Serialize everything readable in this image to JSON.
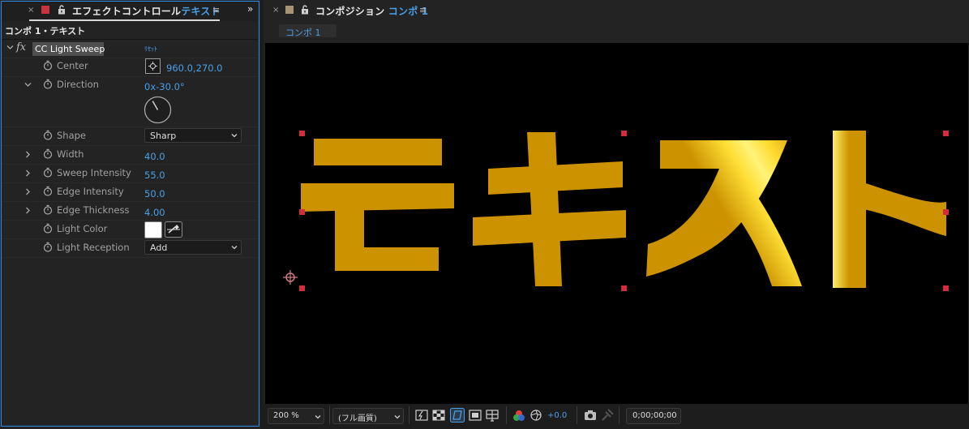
{
  "effect_controls": {
    "tab": {
      "close": "×",
      "lock_icon": "unlock-icon",
      "title": "エフェクトコントロール",
      "layer": "テキスト",
      "menu": "≡",
      "swatch_color": "#c8323c"
    },
    "panel_expand": "»",
    "breadcrumb": "コンポ 1・テキスト",
    "effect": {
      "fx_label": "fx",
      "name": "CC Light Sweep",
      "reset": "ﾘｾｯﾄ"
    },
    "properties": [
      {
        "label": "Center",
        "value": "960.0,270.0"
      },
      {
        "label": "Direction",
        "value_prefix": "0x",
        "value": "-30.0°",
        "dial_angle": -30
      },
      {
        "label": "Shape",
        "value": "Sharp"
      },
      {
        "label": "Width",
        "value": "40.0"
      },
      {
        "label": "Sweep Intensity",
        "value": "55.0"
      },
      {
        "label": "Edge Intensity",
        "value": "50.0"
      },
      {
        "label": "Edge Thickness",
        "value": "4.00"
      },
      {
        "label": "Light Color",
        "value": "#ffffff"
      },
      {
        "label": "Light Reception",
        "value": "Add"
      }
    ]
  },
  "composition": {
    "tab": {
      "close": "×",
      "lock_icon": "unlock-icon",
      "title": "コンポジション",
      "comp": "コンポ 1",
      "menu": "≡",
      "swatch_color": "#a89374"
    },
    "subtab": "コンポ 1",
    "text_layer": {
      "characters": [
        "テ",
        "キ",
        "ス",
        "ト"
      ],
      "fill_color": "#cc9200",
      "highlight_color": "#ffe34d"
    },
    "toolbar": {
      "zoom": "200 %",
      "resolution": "(フル画質)",
      "exposure": "+0.0",
      "timecode": "0;00;00;00"
    }
  }
}
